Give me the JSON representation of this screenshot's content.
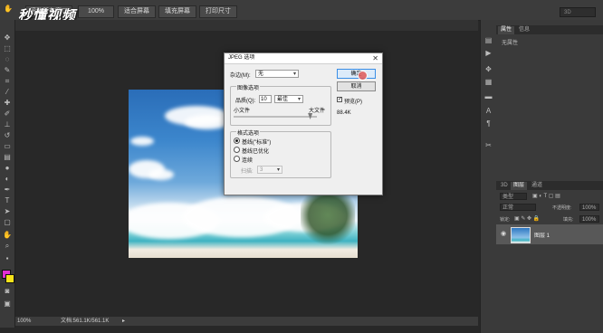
{
  "optbar": {
    "buttons": [
      "滚动所有窗口",
      "100%",
      "适合屏幕",
      "填充屏幕",
      "打印尺寸"
    ],
    "watermark": "秒懂视频",
    "search_3d": "3D"
  },
  "status": {
    "zoom": "100%",
    "doc": "文档:561.1K/561.1K"
  },
  "panel": {
    "tabs_top": [
      "属性",
      "信息"
    ],
    "no_properties": "无属性",
    "tabs_layers": [
      "3D",
      "图层",
      "通道"
    ],
    "filter_kind": "类型",
    "blend_mode": "正常",
    "opacity_label": "不透明度:",
    "opacity_value": "100%",
    "lock_label": "锁定:",
    "fill_label": "填充:",
    "fill_value": "100%",
    "layer_name": "图层 1"
  },
  "dialog": {
    "title": "JPEG 选项",
    "close": "✕",
    "matte_label": "杂边(M):",
    "matte_value": "无",
    "image_options": "图像选项",
    "quality_label": "品质(Q):",
    "quality_value": "10",
    "quality_preset": "最佳",
    "small_file": "小文件",
    "large_file": "大文件",
    "format_options": "格式选项",
    "formats": [
      "基线(\"标准\")",
      "基线已优化",
      "连续"
    ],
    "scans_label": "扫描:",
    "scans_value": "3",
    "ok": "确定",
    "cancel": "取消",
    "preview": "预览(P)",
    "file_size": "88.4K",
    "slider_fraction": 0.92
  }
}
